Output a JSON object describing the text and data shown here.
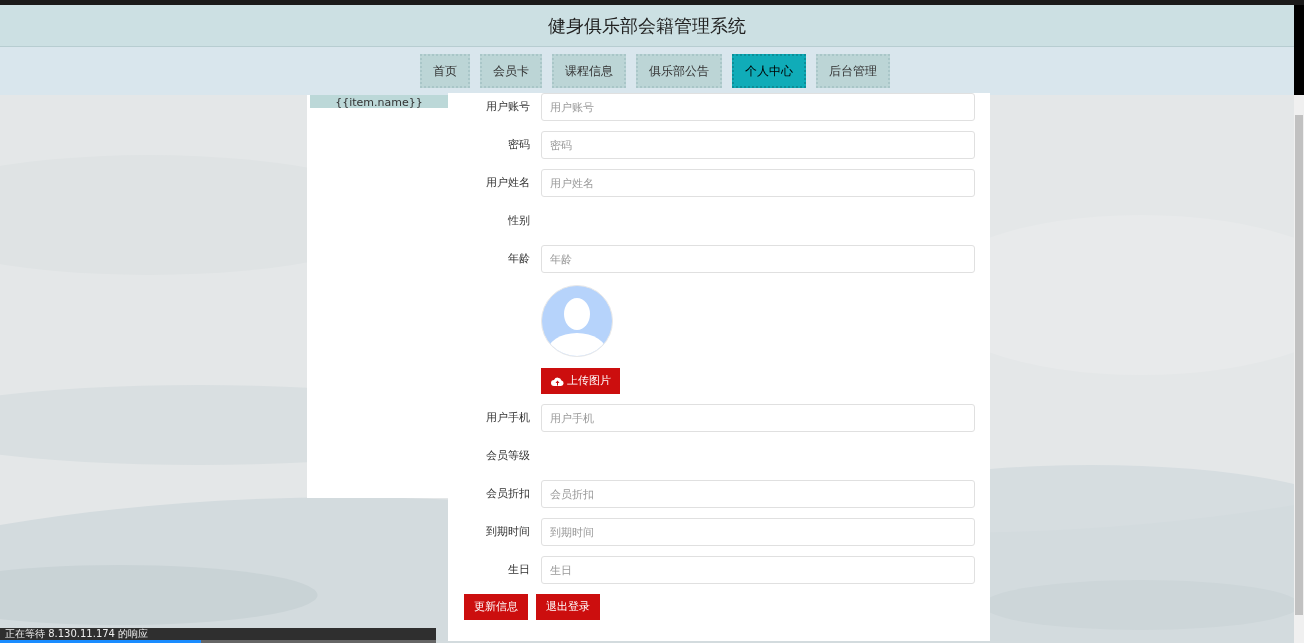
{
  "header": {
    "title": "健身俱乐部会籍管理系统"
  },
  "nav": [
    {
      "label": "首页",
      "selected": false
    },
    {
      "label": "会员卡",
      "selected": false
    },
    {
      "label": "课程信息",
      "selected": false
    },
    {
      "label": "俱乐部公告",
      "selected": false
    },
    {
      "label": "个人中心",
      "selected": true
    },
    {
      "label": "后台管理",
      "selected": false
    }
  ],
  "sidebar": {
    "items": [
      {
        "label": "{{item.name}}"
      }
    ]
  },
  "form": {
    "rows": [
      {
        "kind": "input",
        "label": "用户账号",
        "placeholder": "用户账号"
      },
      {
        "kind": "input",
        "label": "密码",
        "placeholder": "密码"
      },
      {
        "kind": "input",
        "label": "用户姓名",
        "placeholder": "用户姓名"
      },
      {
        "kind": "text",
        "label": "性别"
      },
      {
        "kind": "input",
        "label": "年龄",
        "placeholder": "年龄"
      },
      {
        "kind": "avatar",
        "button": "上传图片"
      },
      {
        "kind": "input",
        "label": "用户手机",
        "placeholder": "用户手机"
      },
      {
        "kind": "text",
        "label": "会员等级"
      },
      {
        "kind": "input",
        "label": "会员折扣",
        "placeholder": "会员折扣"
      },
      {
        "kind": "input",
        "label": "到期时间",
        "placeholder": "到期时间"
      },
      {
        "kind": "input",
        "label": "生日",
        "placeholder": "生日"
      }
    ],
    "buttons": [
      "更新信息",
      "退出登录"
    ]
  },
  "status_bar": {
    "text": "正在等待 8.130.11.174 的响应",
    "level": 0.46
  }
}
